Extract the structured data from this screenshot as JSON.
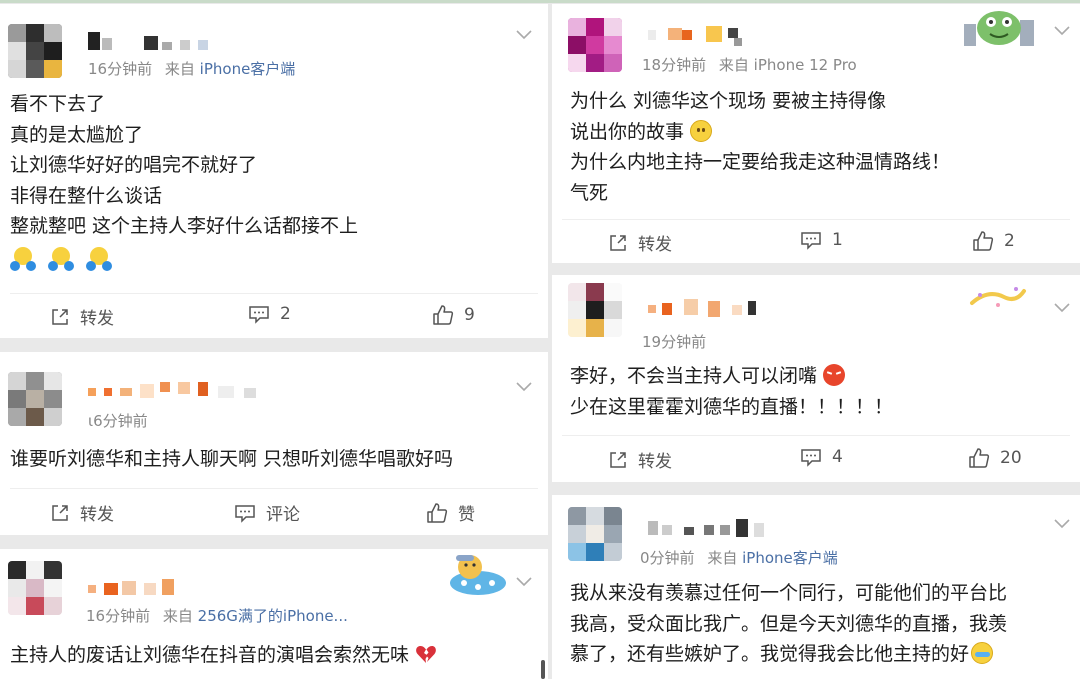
{
  "left": {
    "posts": [
      {
        "name_redacted": true,
        "meta_time": "16分钟前",
        "meta_from": "来自",
        "meta_source": "iPhone客户端",
        "lines": [
          "看不下去了",
          "真的是太尴尬了",
          "让刘德华好好的唱完不就好了",
          "非得在整什么谈话",
          "整就整吧 这个主持人李好什么话都接不上"
        ],
        "actions": {
          "repost": "转发",
          "comment": "2",
          "like": "9"
        }
      },
      {
        "name_redacted": true,
        "meta_time": "ι6分钟前",
        "meta_from": "",
        "meta_source": "",
        "lines": [
          "谁要听刘德华和主持人聊天啊 只想听刘德华唱歌好吗"
        ],
        "actions": {
          "repost": "转发",
          "comment": "评论",
          "like": "赞"
        }
      },
      {
        "name_redacted": true,
        "meta_time": "16分钟前",
        "meta_from": "来自",
        "meta_source": "256G满了的iPhone...",
        "lines": [
          "主持人的废话让刘德华在抖音的演唱会索然无味"
        ]
      }
    ]
  },
  "right": {
    "posts": [
      {
        "name_redacted": true,
        "meta_time": "18分钟前",
        "meta_from": "来自",
        "meta_source": "iPhone 12 Pro",
        "lines": [
          "为什么 刘德华这个现场 要被主持得像",
          "说出你的故事",
          "为什么内地主持一定要给我走这种温情路线！",
          "气死"
        ],
        "actions": {
          "repost": "转发",
          "comment": "1",
          "like": "2"
        }
      },
      {
        "name_redacted": true,
        "meta_time": "19分钟前",
        "meta_from": "",
        "meta_source": "",
        "lines": [
          "李好，不会当主持人可以闭嘴",
          "少在这里霍霍刘德华的直播！！！！！"
        ],
        "actions": {
          "repost": "转发",
          "comment": "4",
          "like": "20"
        }
      },
      {
        "name_redacted": true,
        "meta_time": "0分钟前",
        "meta_from": "来自",
        "meta_source": "iPhone客户端",
        "lines": [
          "我从来没有羡慕过任何一个同行，可能他们的平台比",
          "我高，受众面比我广。但是今天刘德华的直播，我羡",
          "慕了，还有些嫉妒了。我觉得我会比他主持的好"
        ]
      }
    ]
  },
  "colors": {
    "source_link": "#4a6fa5",
    "meta_gray": "#888888",
    "divider": "#eeeeee",
    "background": "#e9e9e9"
  }
}
